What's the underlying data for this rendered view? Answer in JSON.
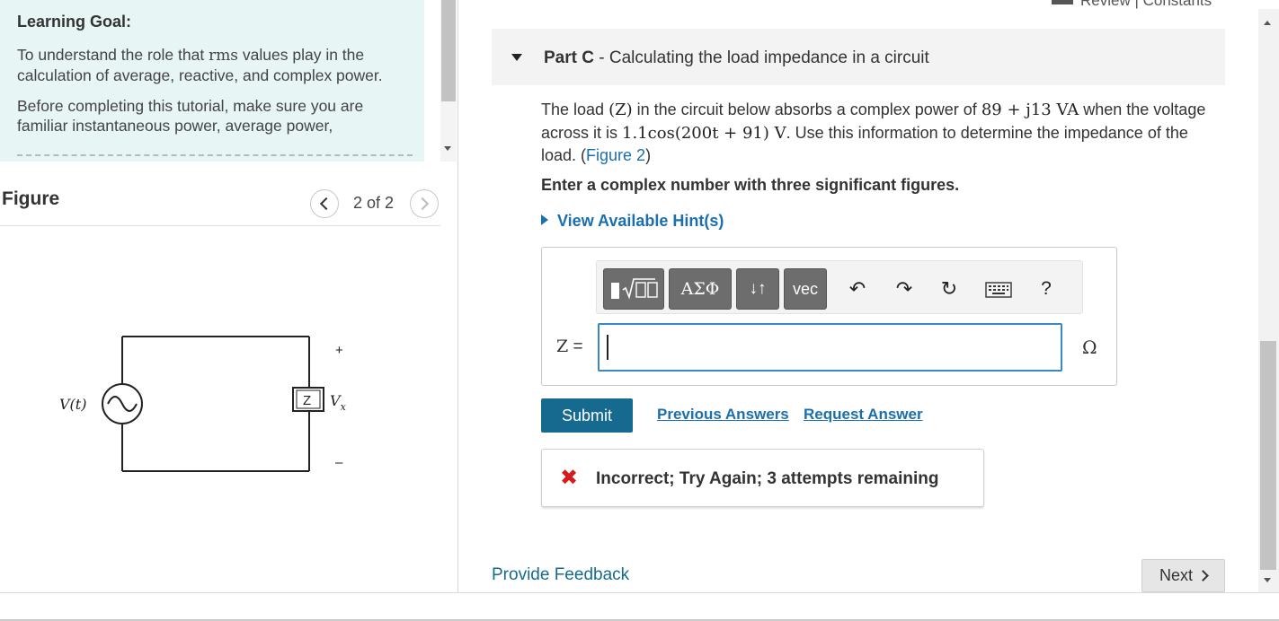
{
  "learning_goal": {
    "title": "Learning Goal:",
    "p1_before": "To understand the role that ",
    "p1_rms": "rms",
    "p1_after": " values play in the calculation of average, reactive, and complex power.",
    "p2": "Before completing this tutorial, make sure you are familiar instantaneous power, average power,"
  },
  "figure": {
    "title": "Figure",
    "page_count": "2 of 2",
    "circuit": {
      "source_label": "V(t)",
      "load_label": "Z",
      "voltage_label": "V",
      "voltage_sub": "x",
      "plus": "+",
      "minus": "–"
    }
  },
  "top_links": {
    "text": "Review | Constants"
  },
  "part": {
    "prefix": "Part C",
    "title": " - Calculating the load impedance in a circuit"
  },
  "question": {
    "t1": "The load ",
    "m1": "(Z)",
    "t2": " in the circuit below absorbs a complex power of ",
    "m2": "89 + j13 VA",
    "t3": " when the voltage across it is ",
    "m3": "1.1cos(200t + 91) V",
    "t4": ". Use this information to determine the impedance of the load. (",
    "figure_link": "Figure 2",
    "t5": ")"
  },
  "instruction": "Enter a complex number with three significant figures.",
  "hint_label": "View Available Hint(s)",
  "toolbar": {
    "templates_icon": "templates-icon",
    "greek_label": "ΑΣΦ",
    "arrows_label": "↓↑",
    "vec_label": "vec",
    "undo_icon": "↶",
    "redo_icon": "↷",
    "reset_icon": "↻",
    "keyboard_icon": "keyboard-icon",
    "help_label": "?"
  },
  "answer": {
    "label_var": "Z",
    "label_eq": " =",
    "value": "",
    "unit": "Ω"
  },
  "buttons": {
    "submit": "Submit",
    "previous_answers": "Previous Answers",
    "request_answer": "Request Answer",
    "next": "Next"
  },
  "feedback": {
    "icon": "✖",
    "text": "Incorrect; Try Again; 3 attempts remaining"
  },
  "provide_feedback": "Provide Feedback",
  "colors": {
    "accent_blue": "#1b6fad",
    "submit_bg": "#176a8f",
    "error_red": "#d51b1b",
    "goal_bg": "#e7f5f5"
  }
}
